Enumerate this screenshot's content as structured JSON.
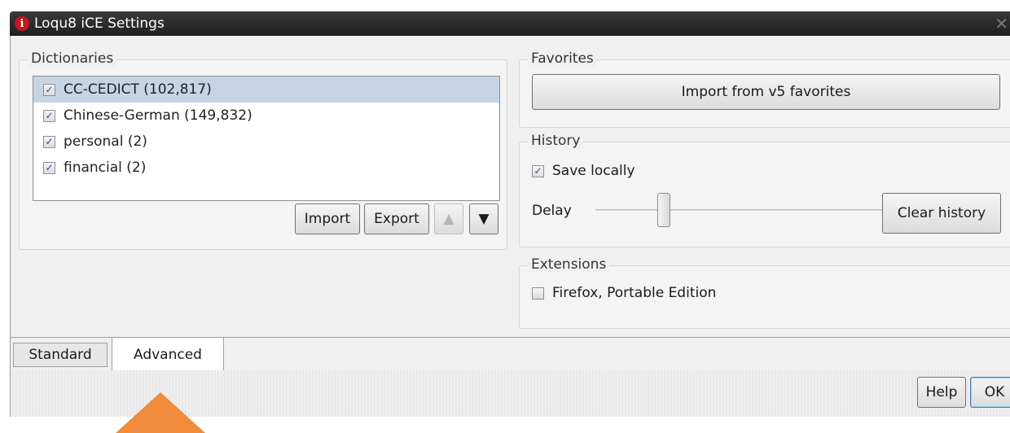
{
  "window": {
    "title": "Loqu8 iCE Settings",
    "app_icon_glyph": "i",
    "close_glyph": "✕"
  },
  "dictionaries": {
    "legend": "Dictionaries",
    "items": [
      {
        "label": "CC-CEDICT (102,817)",
        "checked": true,
        "selected": true
      },
      {
        "label": "Chinese-German (149,832)",
        "checked": true,
        "selected": false
      },
      {
        "label": "personal (2)",
        "checked": true,
        "selected": false
      },
      {
        "label": "financial (2)",
        "checked": true,
        "selected": false
      }
    ],
    "import_label": "Import",
    "export_label": "Export",
    "move_up_glyph": "▲",
    "move_down_glyph": "▼"
  },
  "favorites": {
    "legend": "Favorites",
    "import_button": "Import from v5 favorites"
  },
  "history": {
    "legend": "History",
    "save_locally_label": "Save locally",
    "save_locally_checked": true,
    "delay_label": "Delay",
    "delay_level": 0.2,
    "clear_button": "Clear history"
  },
  "extensions": {
    "legend": "Extensions",
    "firefox_label": "Firefox, Portable Edition",
    "firefox_checked": false
  },
  "tabs": [
    {
      "label": "Standard",
      "active": false
    },
    {
      "label": "Advanced",
      "active": true
    }
  ],
  "footer": {
    "help_label": "Help",
    "ok_label": "OK"
  },
  "colors": {
    "accent_arrow": "#f08c3c",
    "selection": "#c7d4e6",
    "title_bar": "#2a2a2a"
  }
}
